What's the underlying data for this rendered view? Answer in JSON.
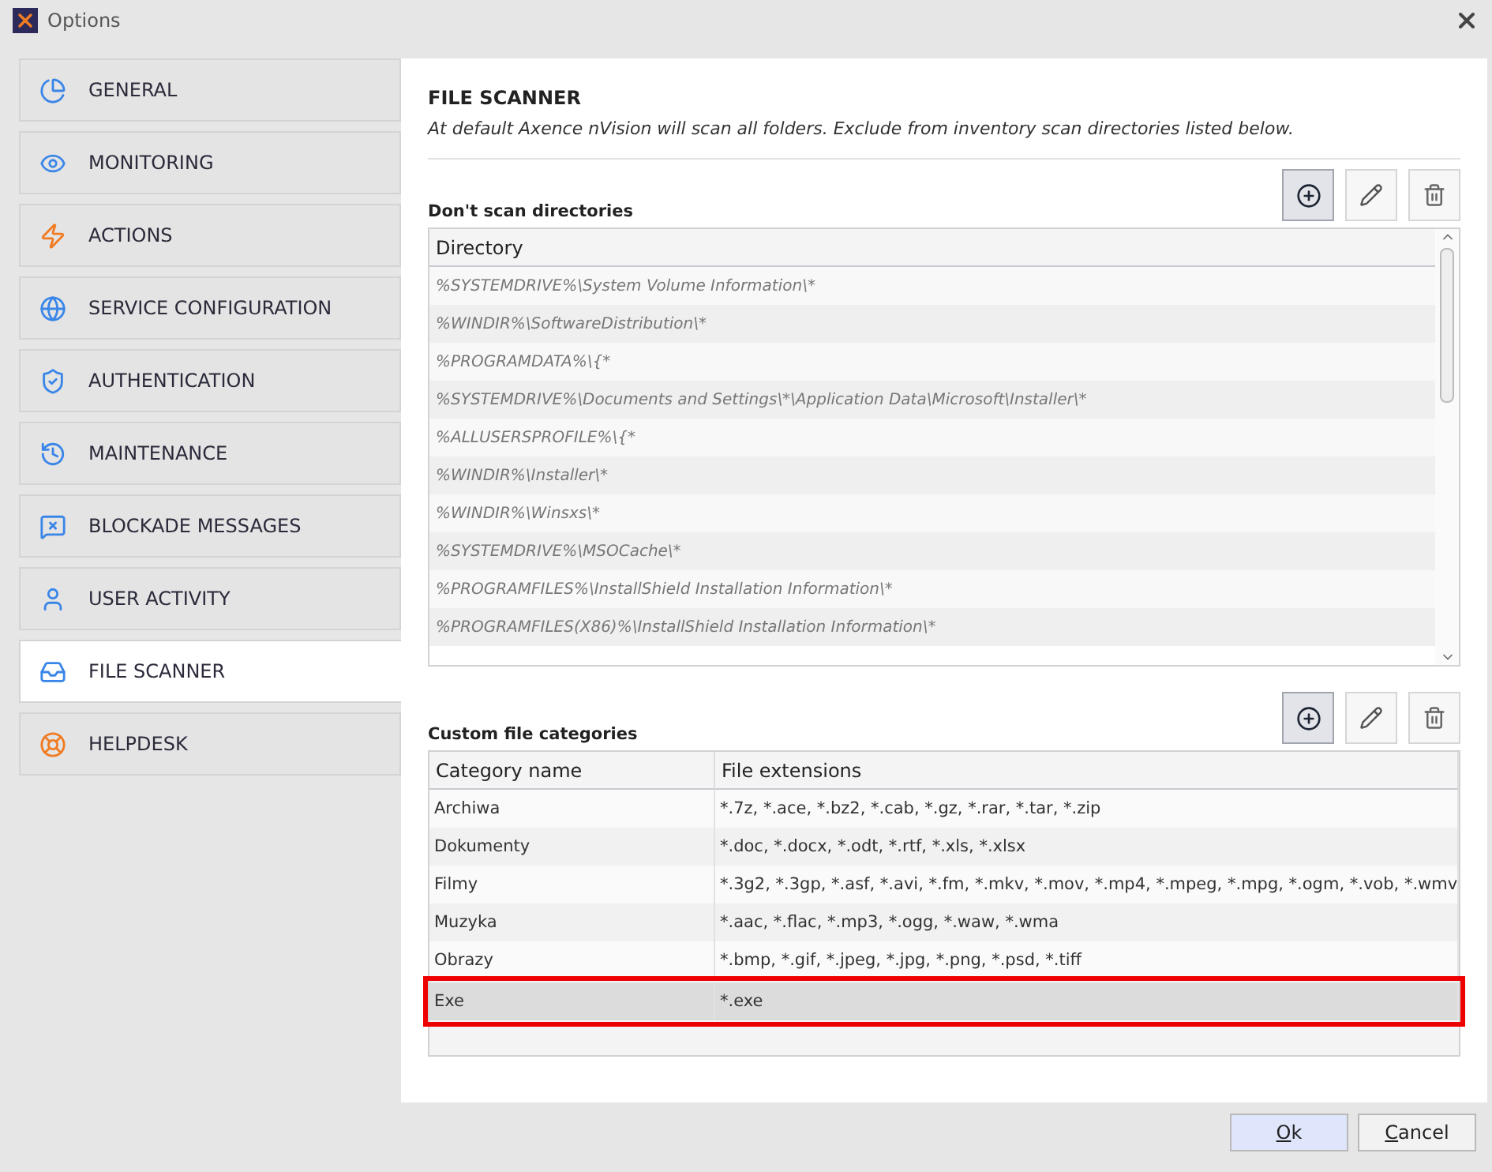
{
  "window": {
    "title": "Options"
  },
  "sidebar": {
    "items": [
      {
        "label": "GENERAL",
        "selected": false
      },
      {
        "label": "MONITORING",
        "selected": false
      },
      {
        "label": "ACTIONS",
        "selected": false
      },
      {
        "label": "SERVICE CONFIGURATION",
        "selected": false
      },
      {
        "label": "AUTHENTICATION",
        "selected": false
      },
      {
        "label": "MAINTENANCE",
        "selected": false
      },
      {
        "label": "BLOCKADE MESSAGES",
        "selected": false
      },
      {
        "label": "USER ACTIVITY",
        "selected": false
      },
      {
        "label": "FILE SCANNER",
        "selected": true
      },
      {
        "label": "HELPDESK",
        "selected": false
      }
    ]
  },
  "content": {
    "title": "FILE SCANNER",
    "description": "At default Axence nVision will scan all folders. Exclude from inventory scan directories listed below.",
    "directories": {
      "label": "Don't scan directories",
      "columns": [
        "Directory"
      ],
      "rows": [
        "%SYSTEMDRIVE%\\System Volume Information\\*",
        "%WINDIR%\\SoftwareDistribution\\*",
        "%PROGRAMDATA%\\{*",
        "%SYSTEMDRIVE%\\Documents and Settings\\*\\Application Data\\Microsoft\\Installer\\*",
        "%ALLUSERSPROFILE%\\{*",
        "%WINDIR%\\Installer\\*",
        "%WINDIR%\\Winsxs\\*",
        "%SYSTEMDRIVE%\\MSOCache\\*",
        "%PROGRAMFILES%\\InstallShield Installation Information\\*",
        "%PROGRAMFILES(X86)%\\InstallShield Installation Information\\*"
      ]
    },
    "categories": {
      "label": "Custom file categories",
      "columns": [
        "Category name",
        "File extensions"
      ],
      "rows": [
        {
          "name": "Archiwa",
          "extensions": "*.7z, *.ace, *.bz2, *.cab, *.gz, *.rar, *.tar, *.zip",
          "selected": false,
          "highlighted": false
        },
        {
          "name": "Dokumenty",
          "extensions": "*.doc, *.docx, *.odt, *.rtf, *.xls, *.xlsx",
          "selected": false,
          "highlighted": false
        },
        {
          "name": "Filmy",
          "extensions": "*.3g2, *.3gp, *.asf, *.avi, *.fm, *.mkv, *.mov, *.mp4, *.mpeg, *.mpg, *.ogm, *.vob, *.wmv",
          "selected": false,
          "highlighted": false
        },
        {
          "name": "Muzyka",
          "extensions": "*.aac, *.flac, *.mp3, *.ogg, *.waw, *.wma",
          "selected": false,
          "highlighted": false
        },
        {
          "name": "Obrazy",
          "extensions": "*.bmp, *.gif, *.jpeg, *.jpg, *.png, *.psd, *.tiff",
          "selected": false,
          "highlighted": false
        },
        {
          "name": "Exe",
          "extensions": "*.exe",
          "selected": true,
          "highlighted": true
        }
      ]
    }
  },
  "buttons": [
    {
      "label": "Ok",
      "default": true
    },
    {
      "label": "Cancel",
      "default": false
    }
  ]
}
